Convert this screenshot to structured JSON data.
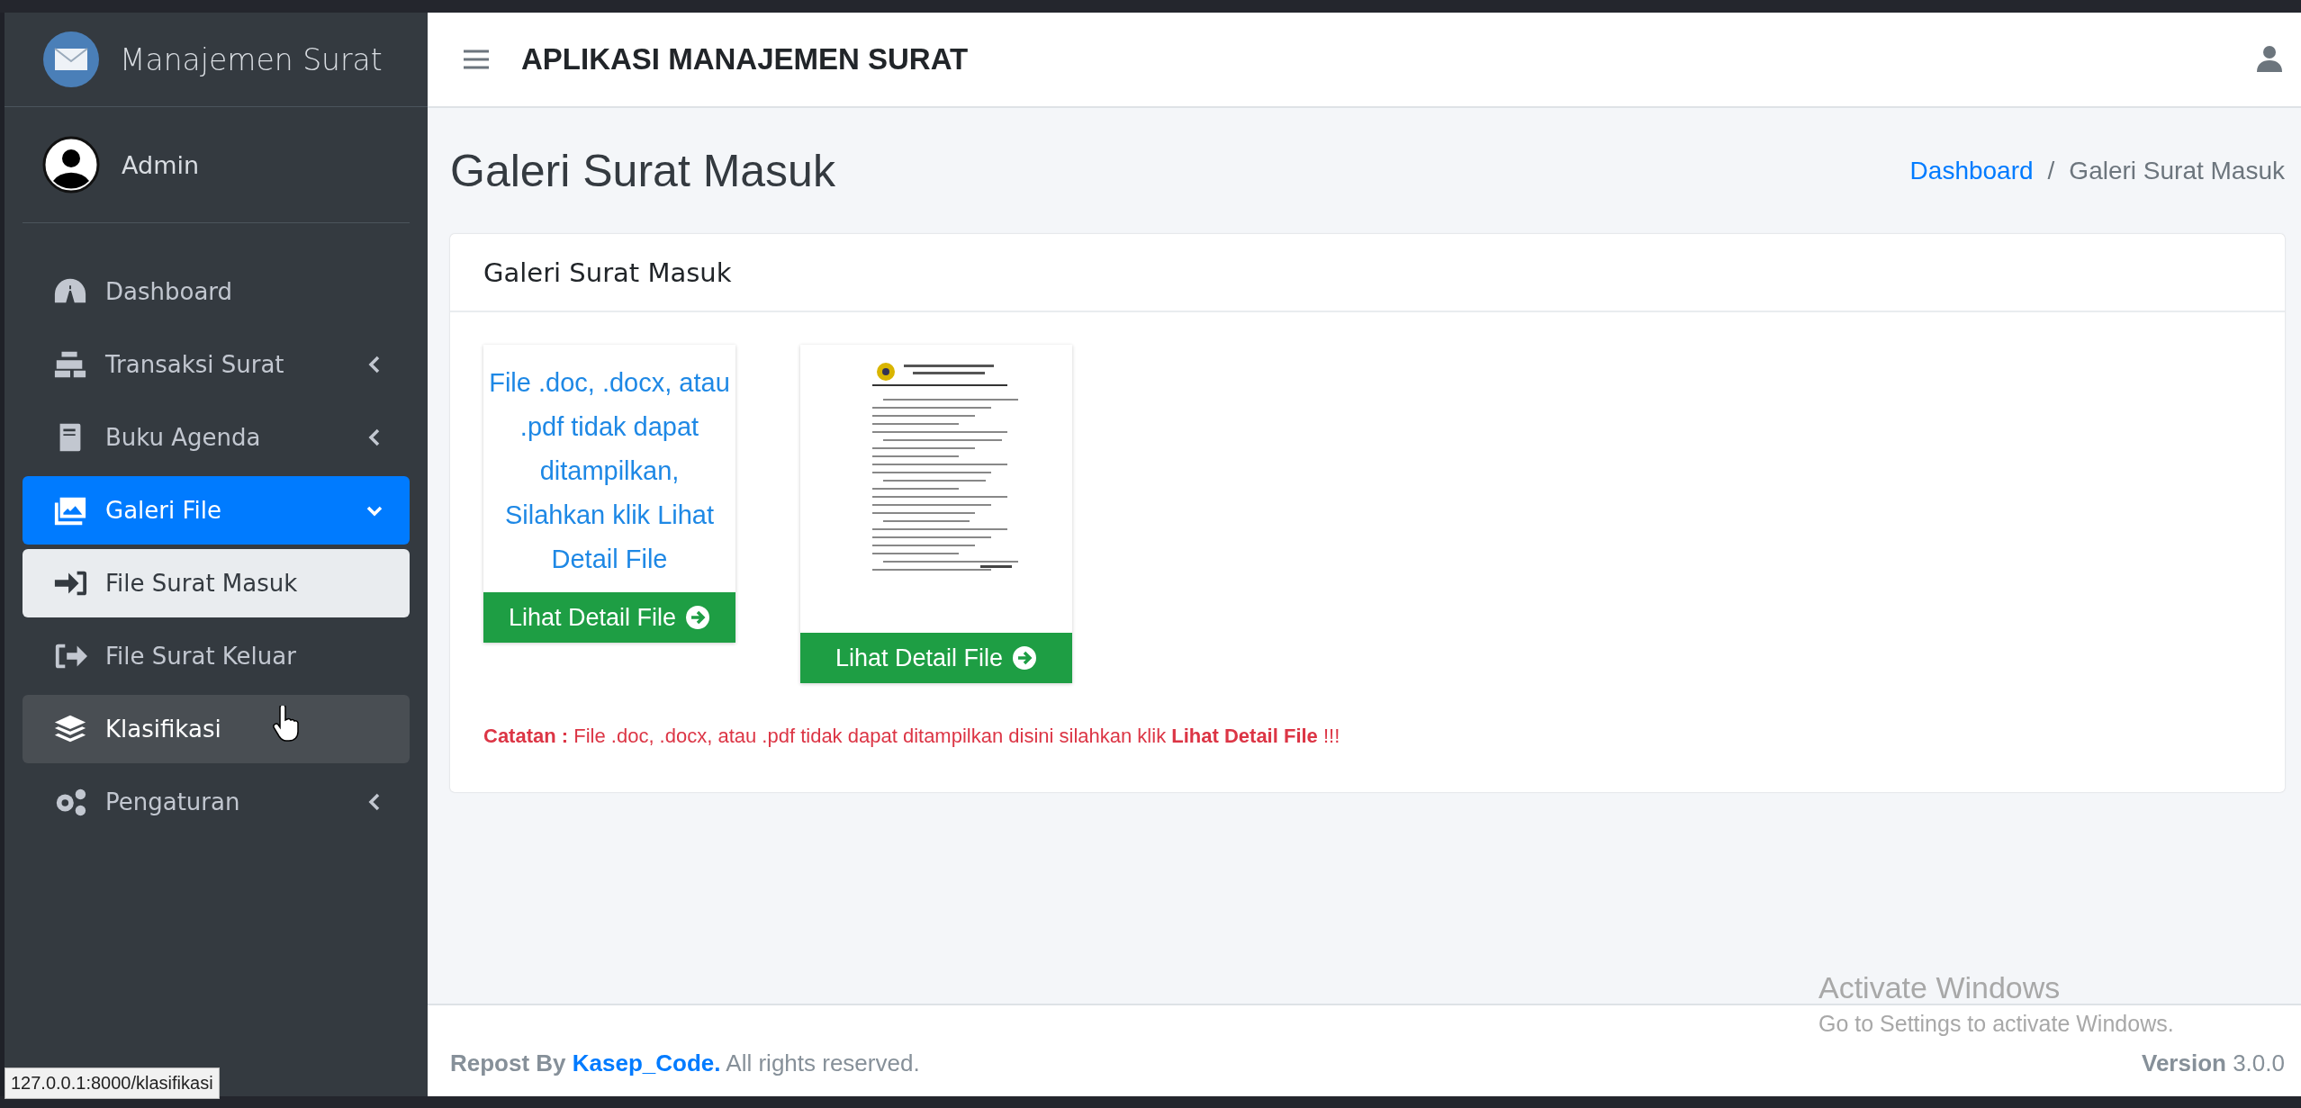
{
  "sidebar": {
    "brand": "Manajemen Surat",
    "user": "Admin",
    "items": [
      {
        "kind": "link",
        "label": "Dashboard",
        "selected": false,
        "hovered": false
      },
      {
        "kind": "group",
        "label": "Transaksi Surat",
        "expanded": false,
        "selected": false,
        "hovered": false
      },
      {
        "kind": "group",
        "label": "Buku Agenda",
        "expanded": false,
        "selected": false,
        "hovered": false
      },
      {
        "kind": "group",
        "label": "Galeri File",
        "expanded": true,
        "selected": true,
        "hovered": false,
        "children": [
          {
            "label": "File Surat Masuk",
            "selected": true,
            "hovered": false
          },
          {
            "label": "File Surat Keluar",
            "selected": false,
            "hovered": false
          }
        ]
      },
      {
        "kind": "link",
        "label": "Klasifikasi",
        "selected": false,
        "hovered": true
      },
      {
        "kind": "group",
        "label": "Pengaturan",
        "expanded": false,
        "selected": false,
        "hovered": false
      }
    ]
  },
  "header": {
    "title": "APLIKASI MANAJEMEN SURAT"
  },
  "page": {
    "title": "Galeri Surat Masuk",
    "breadcrumb": [
      {
        "label": "Dashboard",
        "link": true
      },
      {
        "label": "Galeri Surat Masuk",
        "link": false
      }
    ],
    "breadcrumb_separator": "/"
  },
  "card": {
    "title": "Galeri Surat Masuk",
    "files": [
      {
        "kind": "message",
        "message": "File .doc, .docx, atau .pdf tidak dapat ditampilkan, Silahkan klik Lihat Detail File",
        "button": "Lihat Detail File"
      },
      {
        "kind": "preview",
        "button": "Lihat Detail File"
      }
    ],
    "note": "**Catatan :** File .doc, .docx, atau .pdf tidak dapat ditampilkan disini silahkan klik **Lihat Detail File** !!!"
  },
  "footer": {
    "prefix": "Repost By",
    "link": "Kasep_Code.",
    "suffix": "All rights reserved.",
    "version_label": "Version",
    "version": "3.0.0"
  },
  "status_url": "127.0.0.1:8000/klasifikasi",
  "os_notice": {
    "title": "Activate Windows",
    "subtitle": "Go to Settings to activate Windows."
  }
}
